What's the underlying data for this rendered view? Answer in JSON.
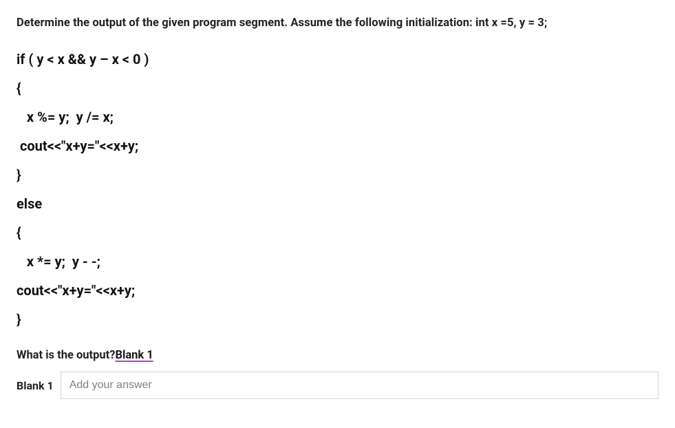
{
  "question": {
    "header": "Determine the output of the given program segment. Assume the following initialization: int x =5, y = 3;",
    "code_lines": [
      "if ( y < x && y – x < 0 )",
      "{",
      "   x %= y;  y /= x;",
      " cout<<\"x+y=\"<<x+y;",
      "}",
      "else",
      "{",
      "   x *= y;  y - -;",
      "cout<<\"x+y=\"<<x+y;",
      "}"
    ],
    "prompt_prefix": "What is the output?",
    "prompt_blank_label": "Blank 1"
  },
  "answer": {
    "label": "Blank 1",
    "placeholder": "Add your answer",
    "value": ""
  }
}
